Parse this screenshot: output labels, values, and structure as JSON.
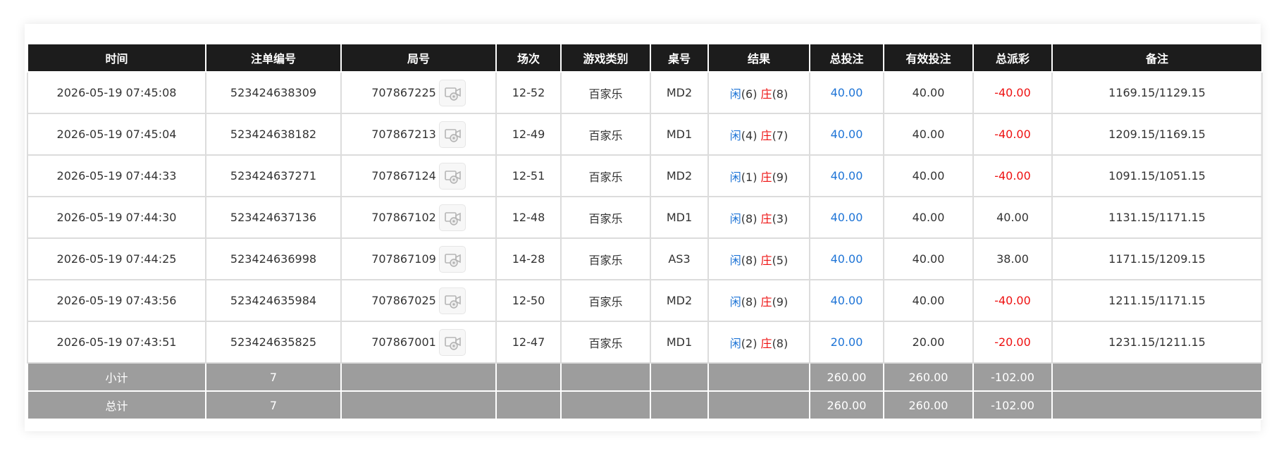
{
  "colors": {
    "header_bg": "#1c1c1c",
    "summary_bg": "#9d9d9d",
    "player_blue": "#1e74d6",
    "banker_red": "#ee1111",
    "negative_red": "#ee1111"
  },
  "table": {
    "headers": {
      "time": "时间",
      "bet_id": "注单编号",
      "round_id": "局号",
      "session": "场次",
      "game_type": "游戏类别",
      "table_no": "桌号",
      "result": "结果",
      "total_bet": "总投注",
      "valid_bet": "有效投注",
      "payout": "总派彩",
      "remark": "备注"
    },
    "detail_icon": "video-replay-icon",
    "rows": [
      {
        "time": "2026-05-19 07:45:08",
        "bet_id": "523424638309",
        "round_id": "707867225",
        "session": "12-52",
        "game_type": "百家乐",
        "table_no": "MD2",
        "player_label": "闲",
        "player_score": "(6)",
        "banker_label": "庄",
        "banker_score": "(8)",
        "total_bet": "40.00",
        "valid_bet": "40.00",
        "payout": "-40.00",
        "remark": "1169.15/1129.15"
      },
      {
        "time": "2026-05-19 07:45:04",
        "bet_id": "523424638182",
        "round_id": "707867213",
        "session": "12-49",
        "game_type": "百家乐",
        "table_no": "MD1",
        "player_label": "闲",
        "player_score": "(4)",
        "banker_label": "庄",
        "banker_score": "(7)",
        "total_bet": "40.00",
        "valid_bet": "40.00",
        "payout": "-40.00",
        "remark": "1209.15/1169.15"
      },
      {
        "time": "2026-05-19 07:44:33",
        "bet_id": "523424637271",
        "round_id": "707867124",
        "session": "12-51",
        "game_type": "百家乐",
        "table_no": "MD2",
        "player_label": "闲",
        "player_score": "(1)",
        "banker_label": "庄",
        "banker_score": "(9)",
        "total_bet": "40.00",
        "valid_bet": "40.00",
        "payout": "-40.00",
        "remark": "1091.15/1051.15"
      },
      {
        "time": "2026-05-19 07:44:30",
        "bet_id": "523424637136",
        "round_id": "707867102",
        "session": "12-48",
        "game_type": "百家乐",
        "table_no": "MD1",
        "player_label": "闲",
        "player_score": "(8)",
        "banker_label": "庄",
        "banker_score": "(3)",
        "total_bet": "40.00",
        "valid_bet": "40.00",
        "payout": "40.00",
        "remark": "1131.15/1171.15"
      },
      {
        "time": "2026-05-19 07:44:25",
        "bet_id": "523424636998",
        "round_id": "707867109",
        "session": "14-28",
        "game_type": "百家乐",
        "table_no": "AS3",
        "player_label": "闲",
        "player_score": "(8)",
        "banker_label": "庄",
        "banker_score": "(5)",
        "total_bet": "40.00",
        "valid_bet": "40.00",
        "payout": "38.00",
        "remark": "1171.15/1209.15"
      },
      {
        "time": "2026-05-19 07:43:56",
        "bet_id": "523424635984",
        "round_id": "707867025",
        "session": "12-50",
        "game_type": "百家乐",
        "table_no": "MD2",
        "player_label": "闲",
        "player_score": "(8)",
        "banker_label": "庄",
        "banker_score": "(9)",
        "total_bet": "40.00",
        "valid_bet": "40.00",
        "payout": "-40.00",
        "remark": "1211.15/1171.15"
      },
      {
        "time": "2026-05-19 07:43:51",
        "bet_id": "523424635825",
        "round_id": "707867001",
        "session": "12-47",
        "game_type": "百家乐",
        "table_no": "MD1",
        "player_label": "闲",
        "player_score": "(2)",
        "banker_label": "庄",
        "banker_score": "(8)",
        "total_bet": "20.00",
        "valid_bet": "20.00",
        "payout": "-20.00",
        "remark": "1231.15/1211.15"
      }
    ],
    "subtotal": {
      "label": "小计",
      "count": "7",
      "total_bet": "260.00",
      "valid_bet": "260.00",
      "payout": "-102.00"
    },
    "grand_total": {
      "label": "总计",
      "count": "7",
      "total_bet": "260.00",
      "valid_bet": "260.00",
      "payout": "-102.00"
    }
  }
}
